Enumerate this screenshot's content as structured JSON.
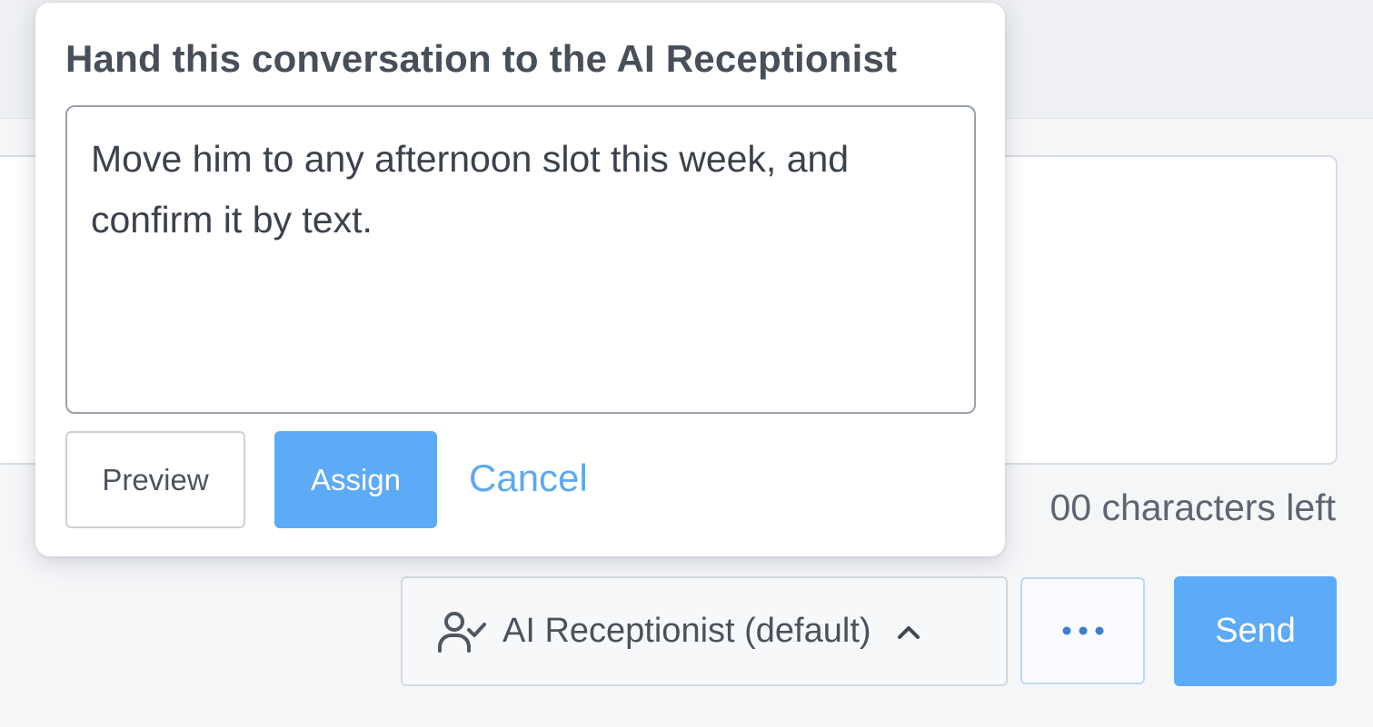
{
  "composer": {
    "char_count_text": "00 characters left"
  },
  "footer": {
    "assign_dropdown": {
      "icon": "user-check-icon",
      "label": "AI Receptionist (default)",
      "chevron_icon": "chevron-up-icon"
    },
    "more_icon": "ellipsis-icon",
    "send_label": "Send"
  },
  "popover": {
    "title": "Hand this conversation to the AI Receptionist",
    "instructions_value": "Move him to any afternoon slot this week, and confirm it by text.",
    "preview_label": "Preview",
    "assign_label": "Assign",
    "cancel_label": "Cancel"
  },
  "colors": {
    "primary": "#5daaf7",
    "link": "#5ea9ef",
    "text": "#3d4550",
    "border": "#d4d8de"
  }
}
